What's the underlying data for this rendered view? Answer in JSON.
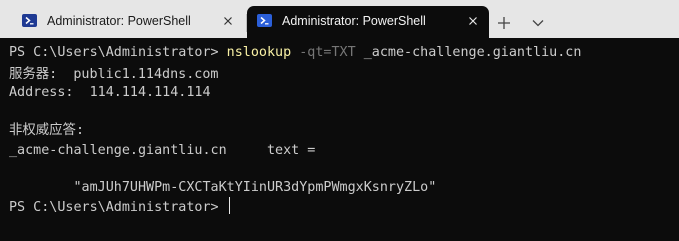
{
  "tabs": [
    {
      "title": "Administrator: PowerShell",
      "icon": "powershell-icon",
      "active": false
    },
    {
      "title": "Administrator: PowerShell",
      "icon": "powershell-icon",
      "active": true
    }
  ],
  "toolbar": {
    "new_tab_icon": "plus-icon",
    "dropdown_icon": "chevron-down-icon"
  },
  "terminal": {
    "prompt": "PS C:\\Users\\Administrator> ",
    "command": {
      "name": "nslookup",
      "param": "-qt=TXT",
      "argument": "_acme-challenge.giantliu.cn"
    },
    "server_line": "服务器:  public1.114dns.com",
    "address_line": "Address:  114.114.114.114",
    "nonauth_line": "非权威应答:",
    "record_line": "_acme-challenge.giantliu.cn     text =",
    "txt_value_line": "        \"amJUh7UHWPm-CXCTaKtYIinUR3dYpmPWmgxKsnryZLo\"",
    "final_prompt": "PS C:\\Users\\Administrator> "
  },
  "colors": {
    "terminal_bg": "#0c0c0c",
    "terminal_fg": "#cccccc",
    "command_color": "#f9f1a5",
    "param_color": "#767676",
    "tabbar_bg": "#e6e6e6"
  }
}
